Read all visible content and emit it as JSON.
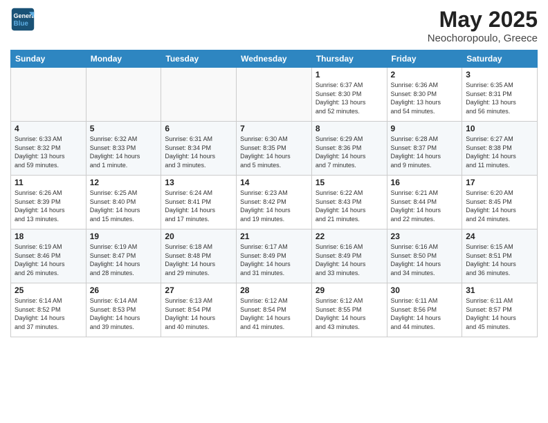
{
  "header": {
    "logo_line1": "General",
    "logo_line2": "Blue",
    "month": "May 2025",
    "location": "Neochoropoulo, Greece"
  },
  "days_of_week": [
    "Sunday",
    "Monday",
    "Tuesday",
    "Wednesday",
    "Thursday",
    "Friday",
    "Saturday"
  ],
  "weeks": [
    [
      {
        "day": "",
        "info": ""
      },
      {
        "day": "",
        "info": ""
      },
      {
        "day": "",
        "info": ""
      },
      {
        "day": "",
        "info": ""
      },
      {
        "day": "1",
        "info": "Sunrise: 6:37 AM\nSunset: 8:30 PM\nDaylight: 13 hours\nand 52 minutes."
      },
      {
        "day": "2",
        "info": "Sunrise: 6:36 AM\nSunset: 8:30 PM\nDaylight: 13 hours\nand 54 minutes."
      },
      {
        "day": "3",
        "info": "Sunrise: 6:35 AM\nSunset: 8:31 PM\nDaylight: 13 hours\nand 56 minutes."
      }
    ],
    [
      {
        "day": "4",
        "info": "Sunrise: 6:33 AM\nSunset: 8:32 PM\nDaylight: 13 hours\nand 59 minutes."
      },
      {
        "day": "5",
        "info": "Sunrise: 6:32 AM\nSunset: 8:33 PM\nDaylight: 14 hours\nand 1 minute."
      },
      {
        "day": "6",
        "info": "Sunrise: 6:31 AM\nSunset: 8:34 PM\nDaylight: 14 hours\nand 3 minutes."
      },
      {
        "day": "7",
        "info": "Sunrise: 6:30 AM\nSunset: 8:35 PM\nDaylight: 14 hours\nand 5 minutes."
      },
      {
        "day": "8",
        "info": "Sunrise: 6:29 AM\nSunset: 8:36 PM\nDaylight: 14 hours\nand 7 minutes."
      },
      {
        "day": "9",
        "info": "Sunrise: 6:28 AM\nSunset: 8:37 PM\nDaylight: 14 hours\nand 9 minutes."
      },
      {
        "day": "10",
        "info": "Sunrise: 6:27 AM\nSunset: 8:38 PM\nDaylight: 14 hours\nand 11 minutes."
      }
    ],
    [
      {
        "day": "11",
        "info": "Sunrise: 6:26 AM\nSunset: 8:39 PM\nDaylight: 14 hours\nand 13 minutes."
      },
      {
        "day": "12",
        "info": "Sunrise: 6:25 AM\nSunset: 8:40 PM\nDaylight: 14 hours\nand 15 minutes."
      },
      {
        "day": "13",
        "info": "Sunrise: 6:24 AM\nSunset: 8:41 PM\nDaylight: 14 hours\nand 17 minutes."
      },
      {
        "day": "14",
        "info": "Sunrise: 6:23 AM\nSunset: 8:42 PM\nDaylight: 14 hours\nand 19 minutes."
      },
      {
        "day": "15",
        "info": "Sunrise: 6:22 AM\nSunset: 8:43 PM\nDaylight: 14 hours\nand 21 minutes."
      },
      {
        "day": "16",
        "info": "Sunrise: 6:21 AM\nSunset: 8:44 PM\nDaylight: 14 hours\nand 22 minutes."
      },
      {
        "day": "17",
        "info": "Sunrise: 6:20 AM\nSunset: 8:45 PM\nDaylight: 14 hours\nand 24 minutes."
      }
    ],
    [
      {
        "day": "18",
        "info": "Sunrise: 6:19 AM\nSunset: 8:46 PM\nDaylight: 14 hours\nand 26 minutes."
      },
      {
        "day": "19",
        "info": "Sunrise: 6:19 AM\nSunset: 8:47 PM\nDaylight: 14 hours\nand 28 minutes."
      },
      {
        "day": "20",
        "info": "Sunrise: 6:18 AM\nSunset: 8:48 PM\nDaylight: 14 hours\nand 29 minutes."
      },
      {
        "day": "21",
        "info": "Sunrise: 6:17 AM\nSunset: 8:49 PM\nDaylight: 14 hours\nand 31 minutes."
      },
      {
        "day": "22",
        "info": "Sunrise: 6:16 AM\nSunset: 8:49 PM\nDaylight: 14 hours\nand 33 minutes."
      },
      {
        "day": "23",
        "info": "Sunrise: 6:16 AM\nSunset: 8:50 PM\nDaylight: 14 hours\nand 34 minutes."
      },
      {
        "day": "24",
        "info": "Sunrise: 6:15 AM\nSunset: 8:51 PM\nDaylight: 14 hours\nand 36 minutes."
      }
    ],
    [
      {
        "day": "25",
        "info": "Sunrise: 6:14 AM\nSunset: 8:52 PM\nDaylight: 14 hours\nand 37 minutes."
      },
      {
        "day": "26",
        "info": "Sunrise: 6:14 AM\nSunset: 8:53 PM\nDaylight: 14 hours\nand 39 minutes."
      },
      {
        "day": "27",
        "info": "Sunrise: 6:13 AM\nSunset: 8:54 PM\nDaylight: 14 hours\nand 40 minutes."
      },
      {
        "day": "28",
        "info": "Sunrise: 6:12 AM\nSunset: 8:54 PM\nDaylight: 14 hours\nand 41 minutes."
      },
      {
        "day": "29",
        "info": "Sunrise: 6:12 AM\nSunset: 8:55 PM\nDaylight: 14 hours\nand 43 minutes."
      },
      {
        "day": "30",
        "info": "Sunrise: 6:11 AM\nSunset: 8:56 PM\nDaylight: 14 hours\nand 44 minutes."
      },
      {
        "day": "31",
        "info": "Sunrise: 6:11 AM\nSunset: 8:57 PM\nDaylight: 14 hours\nand 45 minutes."
      }
    ]
  ]
}
